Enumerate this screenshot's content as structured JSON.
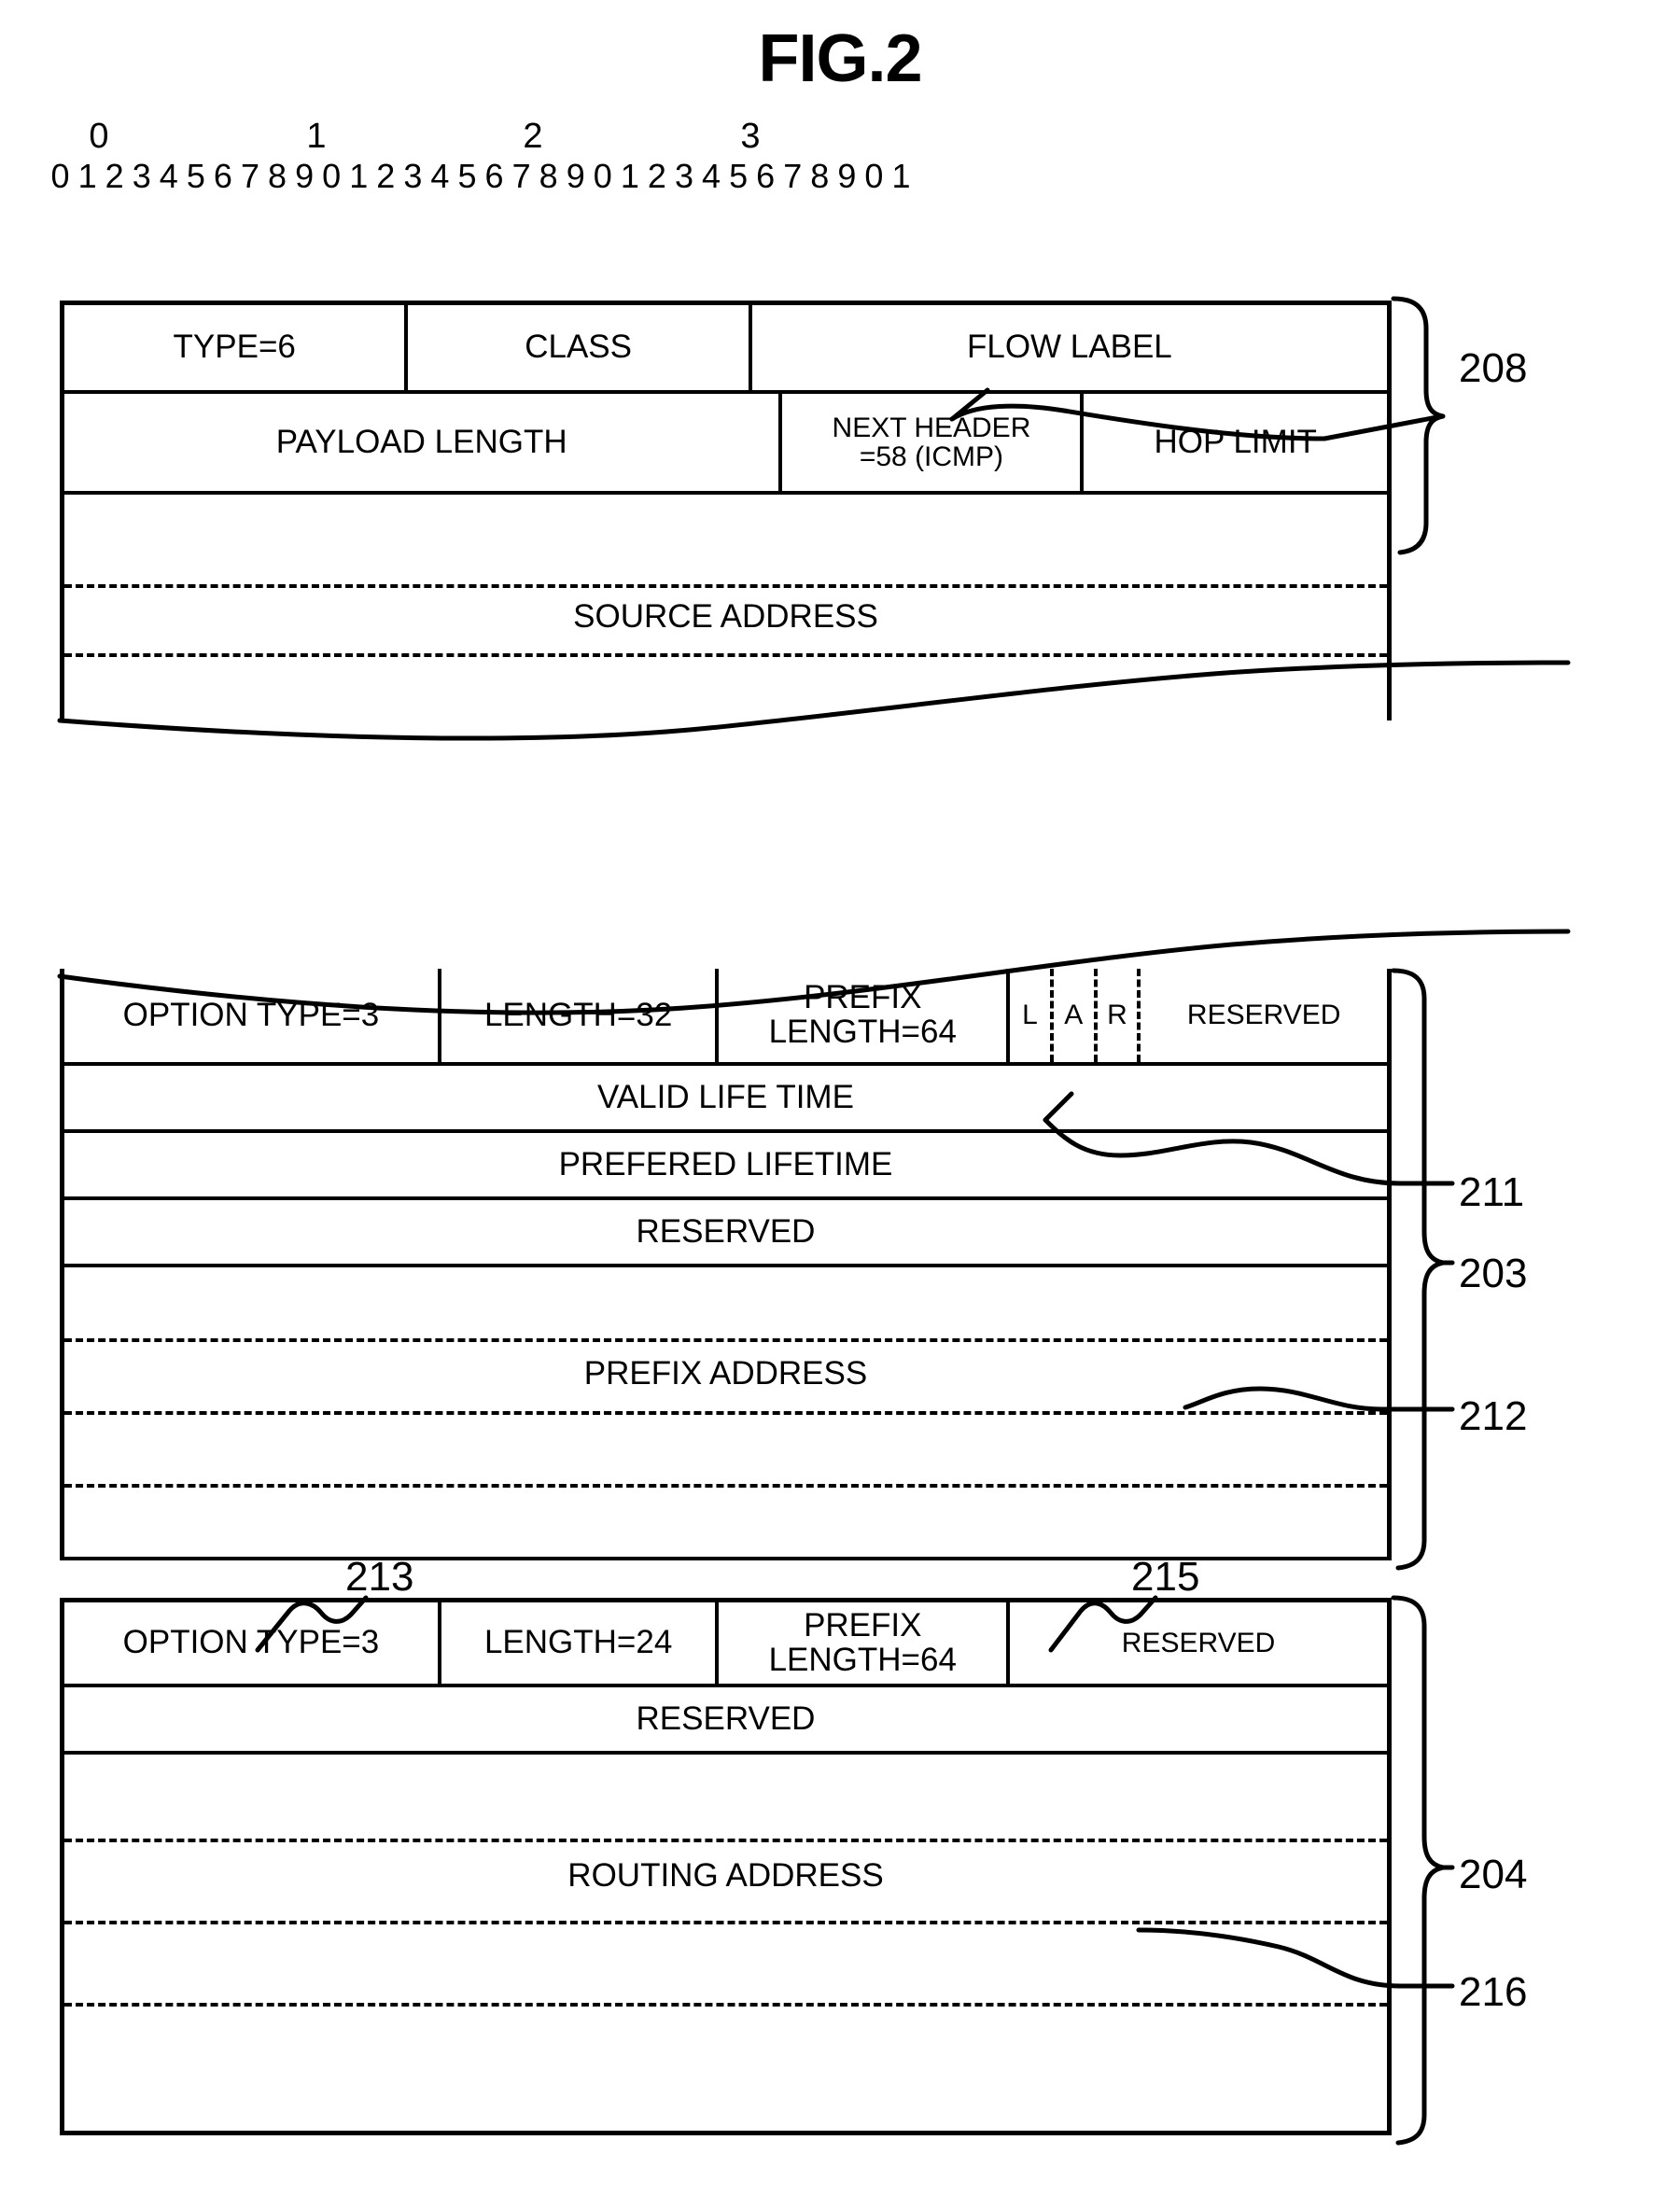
{
  "figure": {
    "title": "FIG.2"
  },
  "ruler": {
    "major": [
      "0",
      "1",
      "2",
      "3"
    ],
    "minor": [
      "0",
      "1",
      "2",
      "3",
      "4",
      "5",
      "6",
      "7",
      "8",
      "9",
      "0",
      "1",
      "2",
      "3",
      "4",
      "5",
      "6",
      "7",
      "8",
      "9",
      "0",
      "1",
      "2",
      "3",
      "4",
      "5",
      "6",
      "7",
      "8",
      "9",
      "0",
      "1"
    ]
  },
  "ipv6_header": {
    "row1": {
      "type": "TYPE=6",
      "class": "CLASS",
      "flow_label": "FLOW LABEL"
    },
    "row2": {
      "payload_length": "PAYLOAD LENGTH",
      "next_header_line1": "NEXT HEADER",
      "next_header_line2": "=58 (ICMP)",
      "hop_limit": "HOP LIMIT"
    },
    "source_address": "SOURCE ADDRESS",
    "callout_208": "208"
  },
  "prefix_option": {
    "option_type": "OPTION TYPE=3",
    "length": "LENGTH=32",
    "prefix_length_line1": "PREFIX",
    "prefix_length_line2": "LENGTH=64",
    "flag_l": "L",
    "flag_a": "A",
    "flag_r": "R",
    "flags_reserved": "RESERVED",
    "valid_life_time": "VALID LIFE TIME",
    "prefered_lifetime": "PREFERED LIFETIME",
    "reserved": "RESERVED",
    "prefix_address": "PREFIX ADDRESS",
    "callout_211": "211",
    "callout_203": "203",
    "callout_212": "212"
  },
  "routing_option": {
    "option_type": "OPTION TYPE=3",
    "length": "LENGTH=24",
    "prefix_length_line1": "PREFIX",
    "prefix_length_line2": "LENGTH=64",
    "reserved_top": "RESERVED",
    "reserved_row": "RESERVED",
    "routing_address": "ROUTING ADDRESS",
    "callout_213": "213",
    "callout_215": "215",
    "callout_204": "204",
    "callout_216": "216"
  }
}
